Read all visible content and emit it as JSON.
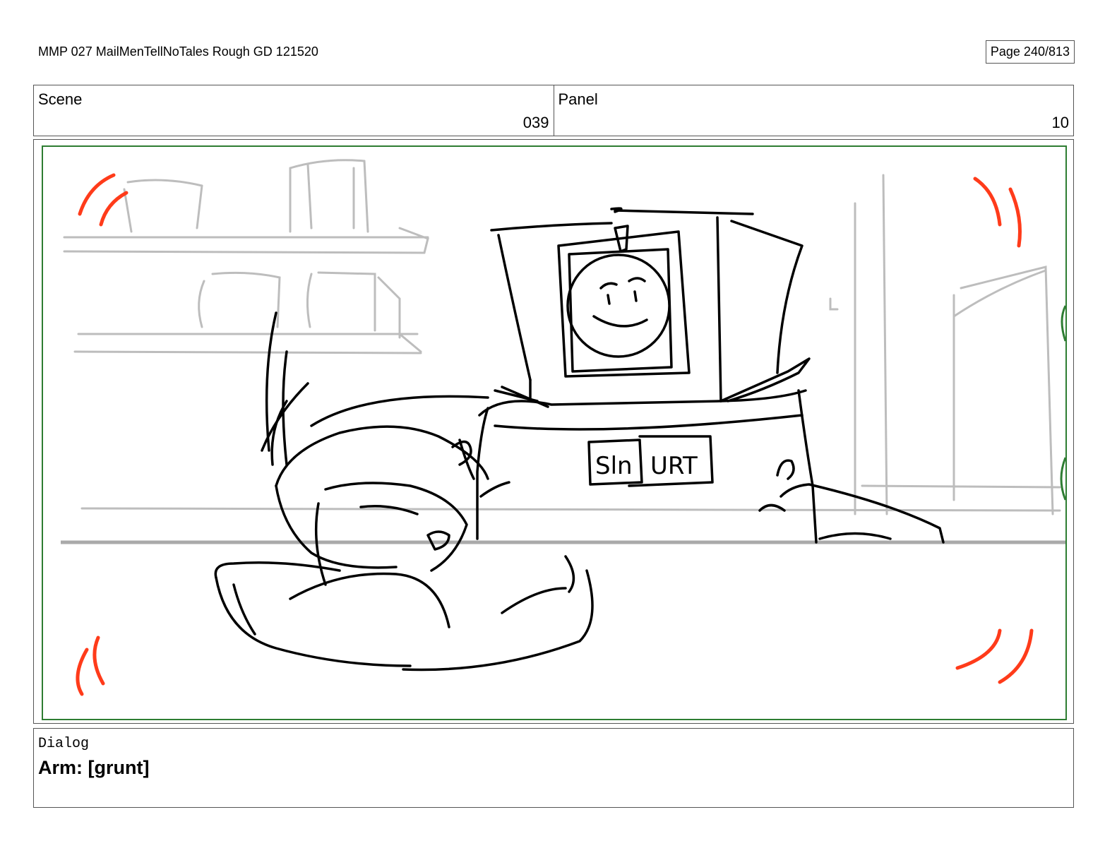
{
  "header": {
    "document_title": "MMP 027 MailMenTellNoTales Rough GD 121520",
    "page_label": "Page 240/813"
  },
  "info": {
    "scene_label": "Scene",
    "scene_value": "039",
    "panel_label": "Panel",
    "panel_value": "10"
  },
  "artwork": {
    "sign_text_left": "Sln",
    "sign_text_right": "URT",
    "frame_color": "#2e7d32",
    "motion_mark_color": "#ff3b1a",
    "background_sketch_color": "#bdbdbd"
  },
  "dialog": {
    "label": "Dialog",
    "text": "Arm: [grunt]"
  }
}
